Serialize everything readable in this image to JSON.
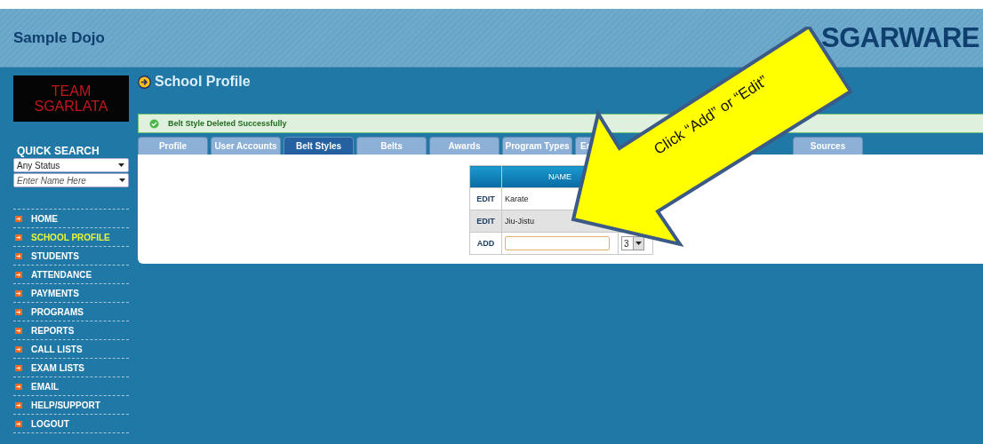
{
  "header": {
    "school_name": "Sample Dojo",
    "brand": "SGARWARE"
  },
  "sidebar": {
    "logo": {
      "line_1": "TEAM",
      "line_2": "SGARLATA"
    },
    "quick_search": {
      "title": "QUICK SEARCH",
      "status_select": "Any Status",
      "name_field": {
        "placeholder": "Enter Name Here"
      }
    },
    "menu": [
      {
        "label": "HOME",
        "selected": false
      },
      {
        "label": "SCHOOL PROFILE",
        "selected": true
      },
      {
        "label": "STUDENTS",
        "selected": false
      },
      {
        "label": "ATTENDANCE",
        "selected": false
      },
      {
        "label": "PAYMENTS",
        "selected": false
      },
      {
        "label": "PROGRAMS",
        "selected": false
      },
      {
        "label": "REPORTS",
        "selected": false
      },
      {
        "label": "CALL LISTS",
        "selected": false
      },
      {
        "label": "EXAM LISTS",
        "selected": false
      },
      {
        "label": "EMAIL",
        "selected": false
      },
      {
        "label": "HELP/SUPPORT",
        "selected": false
      },
      {
        "label": "LOGOUT",
        "selected": false
      }
    ]
  },
  "page_title": "School Profile",
  "message": "Belt Style Deleted Successfully",
  "tabs": [
    {
      "label": "Profile",
      "selected": false
    },
    {
      "label": "User Accounts",
      "selected": false
    },
    {
      "label": "Belt Styles",
      "selected": true
    },
    {
      "label": "Belts",
      "selected": false
    },
    {
      "label": "Awards",
      "selected": false
    },
    {
      "label": "Program Types",
      "selected": false
    },
    {
      "label": "Er",
      "selected": false,
      "cut_off": true
    },
    {
      "label": "Sources",
      "selected": false
    }
  ],
  "table": {
    "columns": [
      "NAME"
    ],
    "rows": [
      {
        "action": "EDIT",
        "name": "Karate"
      },
      {
        "action": "EDIT",
        "name": "Jiu-Jistu"
      }
    ],
    "add_row": {
      "action": "ADD",
      "select_value": "3"
    }
  },
  "callout": "Click “Add” or “Edit”"
}
